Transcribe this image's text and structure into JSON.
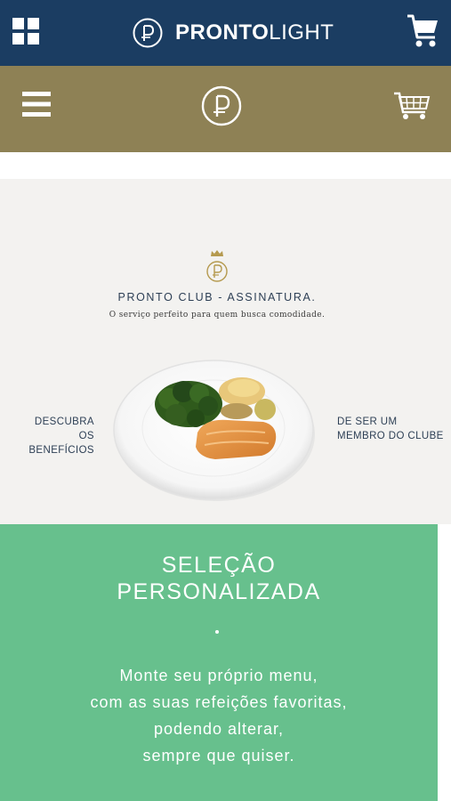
{
  "header": {
    "brand_bold": "PRONTO",
    "brand_light": "LIGHT",
    "menu_icon": "grid-icon",
    "cart_icon": "cart-icon"
  },
  "nav": {
    "menu_icon": "hamburger-icon",
    "logo_icon": "pronto-logo-icon",
    "cart_icon": "shopping-cart-icon"
  },
  "hero": {
    "club_title": "PRONTO CLUB - ASSINATURA.",
    "club_subtitle": "O serviço perfeito para quem busca comodidade.",
    "left_line1": "DESCUBRA",
    "left_line2": "OS BENEFÍCIOS",
    "right_line1": "DE SER UM",
    "right_line2": "MEMBRO DO CLUBE"
  },
  "feature": {
    "title_line1": "SELEÇÃO",
    "title_line2": "PERSONALIZADA",
    "text_line1": "Monte seu próprio menu,",
    "text_line2": "com as suas refeições favoritas,",
    "text_line3": "podendo alterar,",
    "text_line4": "sempre que quiser."
  },
  "colors": {
    "topbar": "#1b3d62",
    "goldbar": "#8e8155",
    "hero_bg": "#f3f2f0",
    "feature_bg": "#67c08d",
    "text_navy": "#2d3f55"
  }
}
